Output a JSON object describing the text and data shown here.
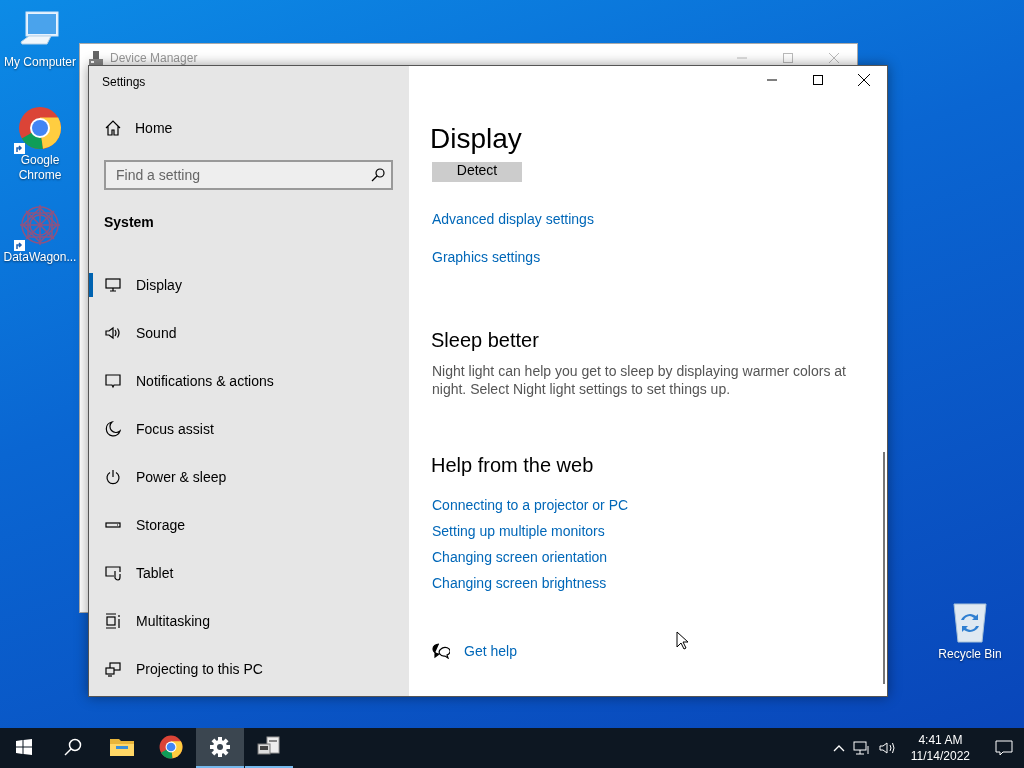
{
  "desktop_icons": [
    {
      "kind": "computer",
      "label": "My Computer",
      "shortcut": false
    },
    {
      "kind": "chrome",
      "label": "Google Chrome",
      "shortcut": true
    },
    {
      "kind": "datawagon",
      "label": "DataWagon...",
      "shortcut": true
    },
    {
      "kind": "recycle",
      "label": "Recycle Bin",
      "shortcut": false
    }
  ],
  "device_manager": {
    "title": "Device Manager"
  },
  "settings": {
    "title": "Settings",
    "home": "Home",
    "search": {
      "placeholder": "Find a setting"
    },
    "section": "System",
    "nav": [
      {
        "label": "Display",
        "selected": true
      },
      {
        "label": "Sound",
        "selected": false
      },
      {
        "label": "Notifications & actions",
        "selected": false
      },
      {
        "label": "Focus assist",
        "selected": false
      },
      {
        "label": "Power & sleep",
        "selected": false
      },
      {
        "label": "Storage",
        "selected": false
      },
      {
        "label": "Tablet",
        "selected": false
      },
      {
        "label": "Multitasking",
        "selected": false
      },
      {
        "label": "Projecting to this PC",
        "selected": false
      }
    ],
    "page": {
      "title": "Display",
      "detect_button": "Detect",
      "links": [
        "Advanced display settings",
        "Graphics settings"
      ],
      "sleep": {
        "heading": "Sleep better",
        "text": "Night light can help you get to sleep by displaying warmer colors at night. Select Night light settings to set things up."
      },
      "help": {
        "heading": "Help from the web",
        "links": [
          "Connecting to a projector or PC",
          "Setting up multiple monitors",
          "Changing screen orientation",
          "Changing screen brightness"
        ]
      },
      "get_help": "Get help"
    }
  },
  "taskbar": {
    "items": [
      {
        "kind": "start",
        "running": false,
        "selected": false
      },
      {
        "kind": "search",
        "running": false,
        "selected": false
      },
      {
        "kind": "explorer",
        "running": false,
        "selected": false
      },
      {
        "kind": "chrome",
        "running": false,
        "selected": false
      },
      {
        "kind": "settings",
        "running": true,
        "selected": true
      },
      {
        "kind": "devmgr",
        "running": true,
        "selected": false
      }
    ],
    "time": "4:41 AM",
    "date": "11/14/2022"
  }
}
